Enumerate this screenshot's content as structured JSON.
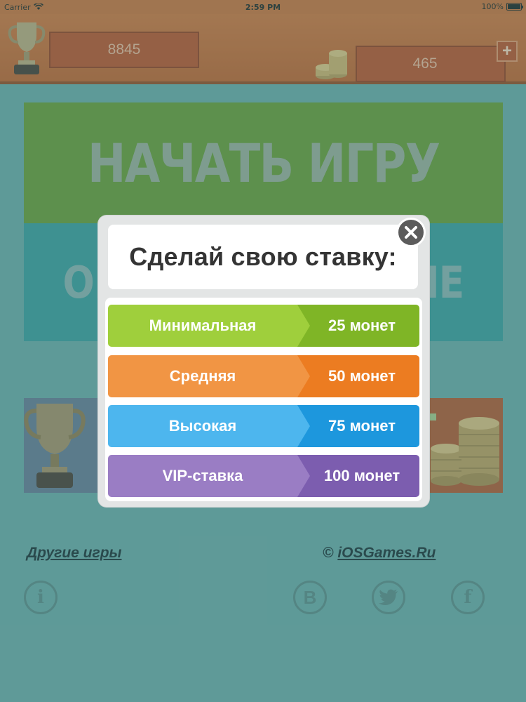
{
  "status_bar": {
    "carrier": "Carrier",
    "time": "2:59 PM",
    "battery": "100%",
    "battery_level": 1.0
  },
  "top_bar": {
    "score": "8845",
    "coins": "465",
    "add_coins_label": "+"
  },
  "menu": {
    "start_game": "НАЧАТЬ ИГРУ",
    "online_partial_left": "ОН",
    "online_partial_right": "ИЕ",
    "other_games": "Другие игры",
    "copyright_symbol": "©",
    "site": "iOSGames.Ru",
    "info_icon_label": "i",
    "vk_icon_label": "В",
    "facebook_icon_label": "f"
  },
  "modal": {
    "title": "Сделай свою ставку:",
    "bets": [
      {
        "name": "Минимальная",
        "price": "25 монет",
        "light": "#9fcf3c",
        "dark": "#7fb526"
      },
      {
        "name": "Средняя",
        "price": "50 монет",
        "light": "#f19544",
        "dark": "#ec7c21"
      },
      {
        "name": "Высокая",
        "price": "75 монет",
        "light": "#4db6ee",
        "dark": "#1d97dd"
      },
      {
        "name": "VIP-ставка",
        "price": "100 монет",
        "light": "#9a7dc4",
        "dark": "#7c5daf"
      }
    ]
  },
  "colors": {
    "overlay": "#5f9a98",
    "top_bar": "#c0591f",
    "start_button": "#5c8b25",
    "online_button": "#2d8d8e"
  },
  "icons": [
    "wifi-icon",
    "trophy-icon",
    "coins-icon",
    "close-icon",
    "info-icon",
    "vk-icon",
    "twitter-icon",
    "facebook-icon"
  ]
}
